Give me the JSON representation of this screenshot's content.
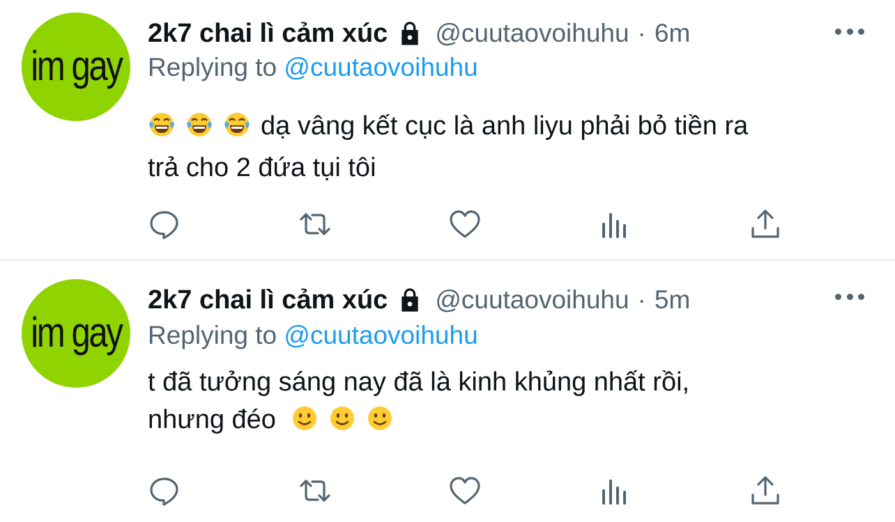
{
  "tweets": [
    {
      "avatar_text": "im gay",
      "display_name": "2k7 chai lì cảm xúc",
      "handle": "@cuutaovoihuhu",
      "separator": "·",
      "time": "6m",
      "replying_prefix": "Replying to",
      "replying_handle": "@cuutaovoihuhu",
      "text_line1": "dạ vâng kết cục là anh liyu phải bỏ tiền ra",
      "text_line2": "trả cho 2 đứa tụi tôi",
      "emojis": [
        "tears-of-joy-emoji",
        "tears-of-joy-emoji",
        "tears-of-joy-emoji"
      ]
    },
    {
      "avatar_text": "im gay",
      "display_name": "2k7 chai lì cảm xúc",
      "handle": "@cuutaovoihuhu",
      "separator": "·",
      "time": "5m",
      "replying_prefix": "Replying to",
      "replying_handle": "@cuutaovoihuhu",
      "text_line1": "t đã tưởng sáng nay đã là kinh khủng nhất rồi,",
      "text_line2": "nhưng đéo",
      "emojis": [
        "slightly-smiling-emoji",
        "slightly-smiling-emoji",
        "slightly-smiling-emoji"
      ]
    }
  ],
  "icons": {
    "reply": "reply-icon",
    "retweet": "retweet-icon",
    "like": "like-icon",
    "views": "views-icon",
    "share": "share-icon",
    "more": "more-icon",
    "lock": "lock-icon"
  },
  "colors": {
    "avatar_bg": "#8fd400",
    "link": "#1d9bf0",
    "secondary_text": "#536471",
    "primary_text": "#0f1419",
    "divider": "#eff3f4"
  }
}
